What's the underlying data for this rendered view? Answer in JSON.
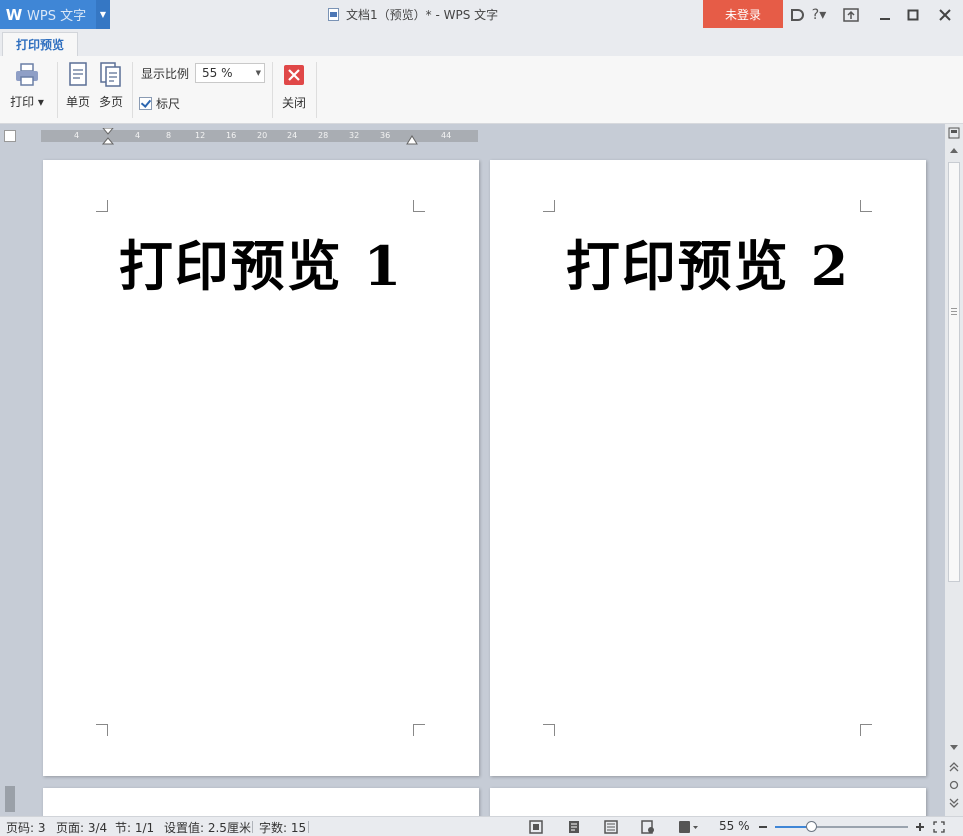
{
  "app": {
    "name": "WPS 文字",
    "logo": "W"
  },
  "window": {
    "title": "文档1（预览）* - WPS 文字",
    "login_label": "未登录"
  },
  "tabs": [
    {
      "label": "打印预览",
      "active": true
    }
  ],
  "ribbon": {
    "print_label": "打印",
    "single_page_label": "单页",
    "multi_page_label": "多页",
    "zoom_label": "显示比例",
    "zoom_value": "55 %",
    "ruler_label": "标尺",
    "ruler_checked": true,
    "close_label": "关闭"
  },
  "ruler": {
    "ticks": [
      "4",
      "4",
      "8",
      "12",
      "16",
      "20",
      "24",
      "28",
      "32",
      "36",
      "44"
    ]
  },
  "pages": [
    {
      "heading": "打印预览 1"
    },
    {
      "heading": "打印预览 2"
    }
  ],
  "status": {
    "page_no": "页码: 3",
    "page_count": "页面: 3/4",
    "section": "节: 1/1",
    "setting": "设置值: 2.5厘米",
    "word_count": "字数: 15",
    "zoom": "55 %",
    "zoom_fraction": 0.27
  },
  "colors": {
    "accent": "#3f86d6",
    "login": "#e65c47",
    "close": "#e04848"
  }
}
